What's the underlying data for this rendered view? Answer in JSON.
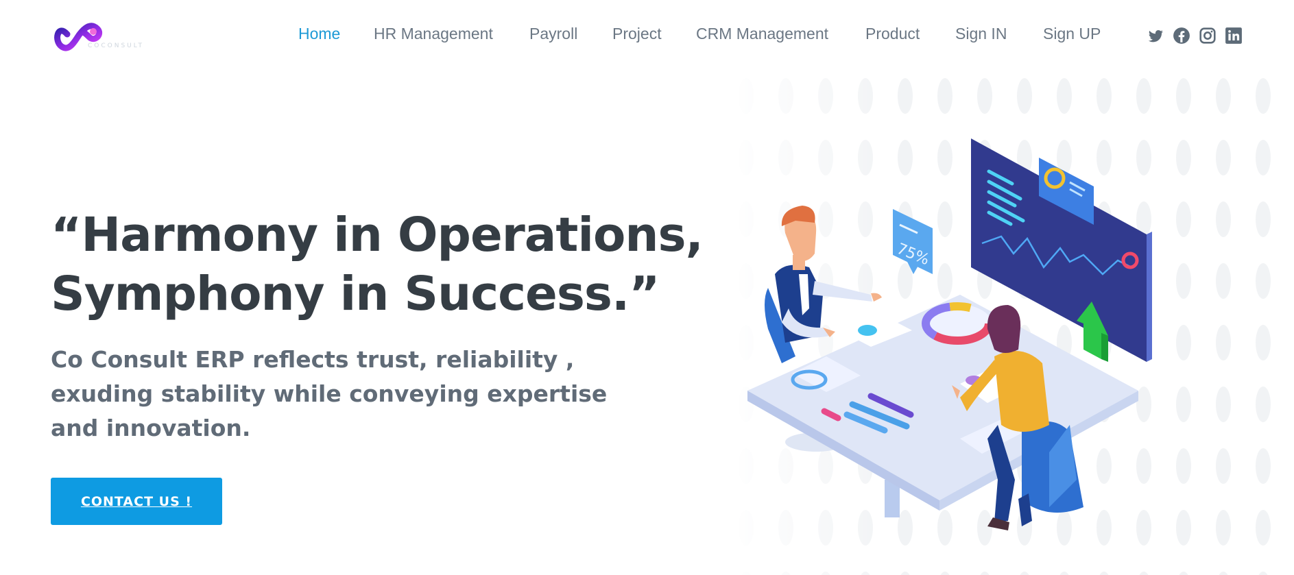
{
  "brand": {
    "logo_name": "infinity-logo",
    "logo_subtext": "COCONSULT"
  },
  "nav": {
    "items": [
      {
        "label": "Home",
        "active": true
      },
      {
        "label": "HR Management"
      },
      {
        "label": "Payroll"
      },
      {
        "label": "Project"
      },
      {
        "label": "CRM Management"
      },
      {
        "label": "Product"
      },
      {
        "label": "Sign IN"
      },
      {
        "label": "Sign UP"
      }
    ]
  },
  "social": [
    "twitter-icon",
    "facebook-icon",
    "instagram-icon",
    "linkedin-icon"
  ],
  "hero": {
    "title_line1": "“Harmony in Operations,",
    "title_line2": "Symphony in Success.”",
    "description": "Co Consult ERP reflects trust, reliability , exuding stability while conveying expertise and innovation.",
    "cta_label": "CONTACT US !"
  },
  "illustration": {
    "badge_text": "75%"
  },
  "colors": {
    "accent": "#1e9ad6",
    "cta": "#0e9be2",
    "heading": "#353d44",
    "nav": "#6b7784",
    "screen": "#2f3a8f"
  }
}
